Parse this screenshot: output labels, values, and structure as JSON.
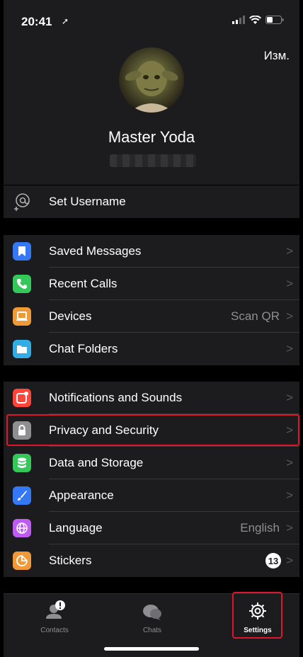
{
  "status": {
    "time": "20:41"
  },
  "profile": {
    "edit_label": "Изм.",
    "name": "Master Yoda"
  },
  "username": {
    "label": "Set Username"
  },
  "group1": [
    {
      "label": "Saved Messages",
      "icon": "bookmark-icon",
      "color": "#3478f6"
    },
    {
      "label": "Recent Calls",
      "icon": "phone-icon",
      "color": "#34c759"
    },
    {
      "label": "Devices",
      "icon": "laptop-icon",
      "color": "#f09a37",
      "value": "Scan QR"
    },
    {
      "label": "Chat Folders",
      "icon": "folder-icon",
      "color": "#32ade6"
    }
  ],
  "group2": [
    {
      "label": "Notifications and Sounds",
      "icon": "bell-icon",
      "color": "#ff453a"
    },
    {
      "label": "Privacy and Security",
      "icon": "lock-icon",
      "color": "#8e8e93"
    },
    {
      "label": "Data and Storage",
      "icon": "database-icon",
      "color": "#34c759"
    },
    {
      "label": "Appearance",
      "icon": "brush-icon",
      "color": "#3478f6"
    },
    {
      "label": "Language",
      "icon": "globe-icon",
      "color": "#bf5af2",
      "value": "English"
    },
    {
      "label": "Stickers",
      "icon": "sticker-icon",
      "color": "#f09a37",
      "badge": "13"
    }
  ],
  "tabs": [
    {
      "label": "Contacts",
      "icon": "contacts-icon"
    },
    {
      "label": "Chats",
      "icon": "chats-icon"
    },
    {
      "label": "Settings",
      "icon": "settings-icon",
      "active": true
    }
  ],
  "colors": {
    "highlight": "#e0142c",
    "background": "#1c1c1e"
  }
}
